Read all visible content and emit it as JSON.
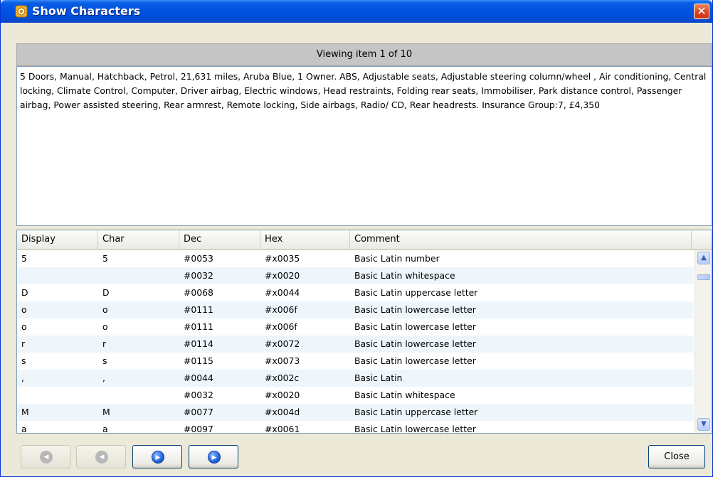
{
  "window": {
    "title": "Show Characters",
    "close_glyph": "✕",
    "accent": "#0054e3"
  },
  "viewing": {
    "text": "Viewing item 1 of 10"
  },
  "description": "5 Doors, Manual, Hatchback, Petrol, 21,631 miles, Aruba Blue, 1 Owner. ABS, Adjustable seats, Adjustable steering column/wheel , Air conditioning, Central locking, Climate Control, Computer, Driver airbag, Electric windows, Head restraints, Folding rear seats, Immobiliser, Park distance control, Passenger airbag, Power assisted steering, Rear armrest, Remote locking, Side airbags, Radio/ CD, Rear headrests. Insurance Group:7, £4,350",
  "grid": {
    "columns": [
      "Display",
      "Char",
      "Dec",
      "Hex",
      "Comment"
    ],
    "rows": [
      {
        "display": "5",
        "char": "5",
        "dec": "#0053",
        "hex": "#x0035",
        "comment": "Basic Latin number"
      },
      {
        "display": "",
        "char": "",
        "dec": "#0032",
        "hex": "#x0020",
        "comment": "Basic Latin whitespace"
      },
      {
        "display": "D",
        "char": "D",
        "dec": "#0068",
        "hex": "#x0044",
        "comment": "Basic Latin uppercase letter"
      },
      {
        "display": "o",
        "char": "o",
        "dec": "#0111",
        "hex": "#x006f",
        "comment": "Basic Latin lowercase letter"
      },
      {
        "display": "o",
        "char": "o",
        "dec": "#0111",
        "hex": "#x006f",
        "comment": "Basic Latin lowercase letter"
      },
      {
        "display": "r",
        "char": "r",
        "dec": "#0114",
        "hex": "#x0072",
        "comment": "Basic Latin lowercase letter"
      },
      {
        "display": "s",
        "char": "s",
        "dec": "#0115",
        "hex": "#x0073",
        "comment": "Basic Latin lowercase letter"
      },
      {
        "display": ",",
        "char": ",",
        "dec": "#0044",
        "hex": "#x002c",
        "comment": "Basic Latin"
      },
      {
        "display": "",
        "char": "",
        "dec": "#0032",
        "hex": "#x0020",
        "comment": "Basic Latin whitespace"
      },
      {
        "display": "M",
        "char": "M",
        "dec": "#0077",
        "hex": "#x004d",
        "comment": "Basic Latin uppercase letter"
      },
      {
        "display": "a",
        "char": "a",
        "dec": "#0097",
        "hex": "#x0061",
        "comment": "Basic Latin lowercase letter"
      }
    ],
    "scroll_up_glyph": "▲",
    "scroll_down_glyph": "▼"
  },
  "nav": {
    "first": {
      "icon": "first-icon",
      "glyph": "◀",
      "enabled": false
    },
    "prev": {
      "icon": "previous-icon",
      "glyph": "◀",
      "enabled": false
    },
    "next": {
      "icon": "next-icon",
      "glyph": "▶",
      "enabled": true
    },
    "last": {
      "icon": "last-icon",
      "glyph": "▶",
      "enabled": true
    }
  },
  "close_label": "Close"
}
